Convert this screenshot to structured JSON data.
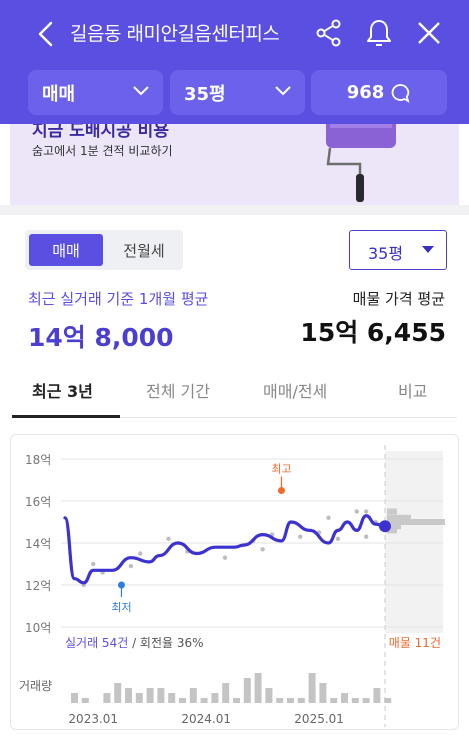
{
  "header": {
    "title": "길음동 래미안길음센터피스",
    "filter_trade": "매매",
    "filter_area": "35평",
    "comment_count": "968"
  },
  "banner": {
    "headline": "지금 도배시공 비용",
    "subtitle": "숨고에서 1분 견적 비교하기"
  },
  "controls": {
    "segments": [
      "매매",
      "전월세"
    ],
    "area_select": "35평"
  },
  "summary": {
    "left_label": "최근 실거래 기준 1개월 평균",
    "left_value": "14억 8,000",
    "right_label": "매물 가격 평균",
    "right_value": "15억 6,455"
  },
  "tabs": [
    "최근 3년",
    "전체 기간",
    "매매/전세",
    "비교"
  ],
  "chart": {
    "y_ticks": [
      "18억",
      "16억",
      "14억",
      "12억",
      "10억"
    ],
    "x_ticks": [
      "2023.01",
      "2024.01",
      "2025.01"
    ],
    "high_label": "최고",
    "low_label": "최저",
    "volume_label": "거래량",
    "trade_prefix": "실거래",
    "trade_count": "54건",
    "turnover": "/ 회전율 36%",
    "listing_count": "매물 11건"
  },
  "colors": {
    "primary": "#5a4fe0",
    "line": "#3c32d0",
    "high": "#f06a2c",
    "low": "#2f7de1"
  },
  "chart_data": {
    "type": "line",
    "ylim": [
      10,
      18
    ],
    "unit": "억",
    "series": [
      {
        "x": [
          "2022.10",
          "2022.11",
          "2022.12",
          "2023.01",
          "2023.03",
          "2023.05",
          "2023.07",
          "2023.08",
          "2023.10",
          "2023.12",
          "2024.02",
          "2024.04",
          "2024.05",
          "2024.07",
          "2024.09",
          "2024.10",
          "2024.12",
          "2025.02",
          "2025.03",
          "2025.04",
          "2025.05",
          "2025.06",
          "2025.07",
          "2025.08"
        ],
        "values": [
          15.2,
          12.3,
          12.1,
          12.7,
          12.7,
          13.3,
          13.1,
          13.4,
          14.0,
          13.5,
          13.8,
          13.8,
          13.9,
          14.4,
          14.1,
          15.0,
          14.6,
          14.0,
          14.6,
          15.0,
          14.6,
          15.3,
          14.9,
          14.8
        ]
      }
    ],
    "high": {
      "x": "2024.09",
      "value": 16.5
    },
    "low": {
      "x": "2023.04",
      "value": 12.0
    },
    "volume": [
      2,
      1,
      0,
      2,
      4,
      3,
      2,
      3,
      3,
      2,
      1,
      3,
      1,
      2,
      4,
      1,
      5,
      6,
      3,
      1,
      1,
      1,
      6,
      4,
      1,
      2,
      1,
      1,
      3,
      1
    ]
  }
}
